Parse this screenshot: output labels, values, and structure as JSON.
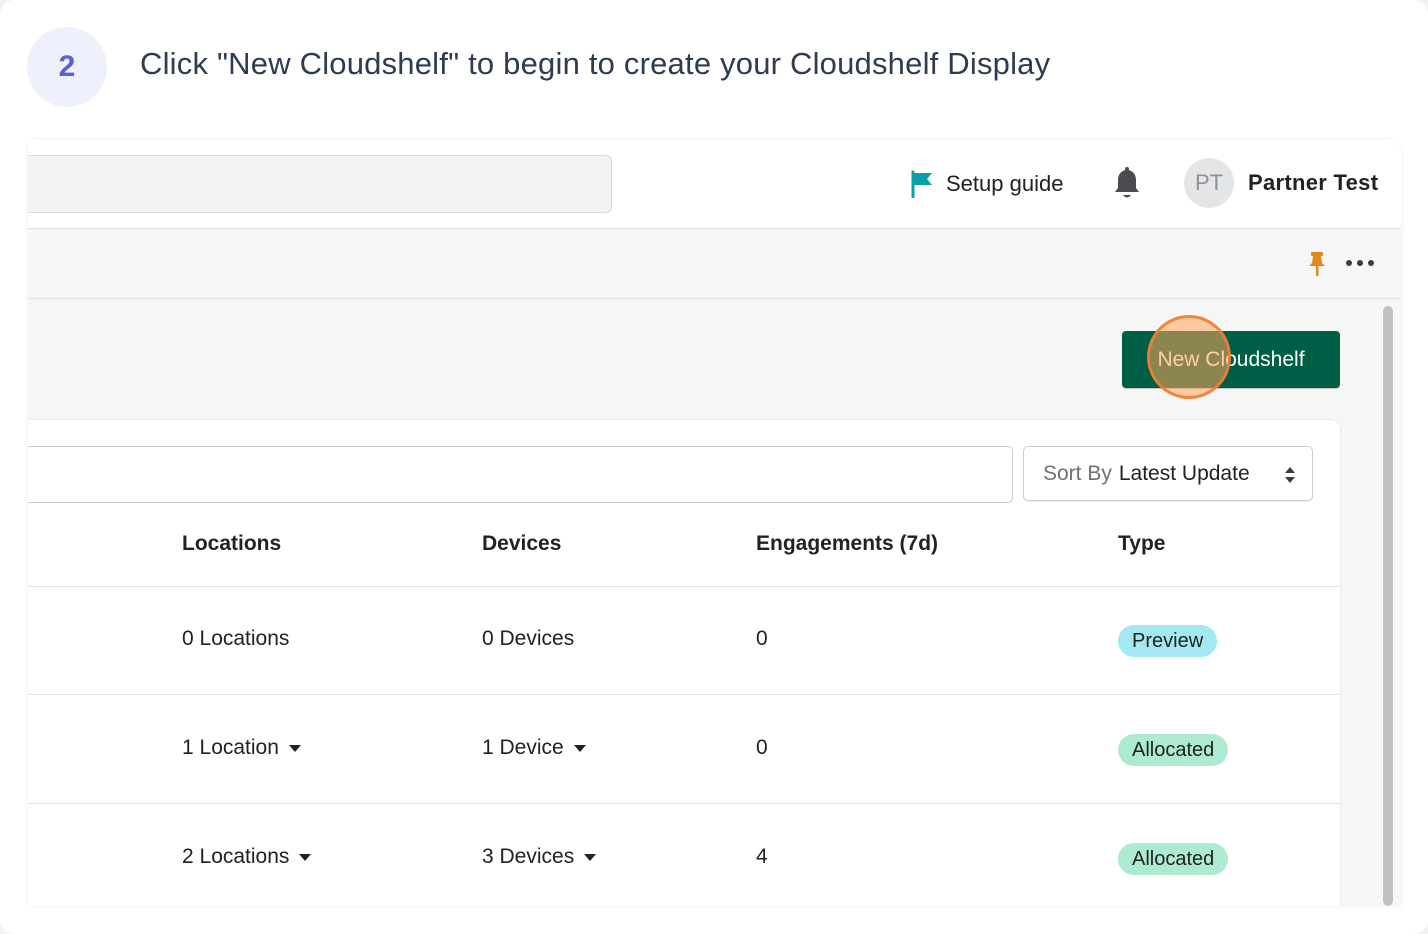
{
  "step": {
    "number": "2",
    "instruction": "Click \"New Cloudshelf\" to begin to create your Cloudshelf Display"
  },
  "topbar": {
    "setup_guide": "Setup guide",
    "avatar_initials": "PT",
    "user_name": "Partner Test"
  },
  "page": {
    "new_button_label": "New Cloudshelf",
    "sort": {
      "prefix": "Sort By",
      "selected": "Latest Update"
    }
  },
  "table": {
    "headers": [
      "Locations",
      "Devices",
      "Engagements (7d)",
      "Type"
    ],
    "rows": [
      {
        "locations": "0 Locations",
        "locations_dropdown": false,
        "devices": "0 Devices",
        "devices_dropdown": false,
        "engagements": "0",
        "type": "Preview"
      },
      {
        "locations": "1 Location",
        "locations_dropdown": true,
        "devices": "1 Device",
        "devices_dropdown": true,
        "engagements": "0",
        "type": "Allocated"
      },
      {
        "locations": "2 Locations",
        "locations_dropdown": true,
        "devices": "3 Devices",
        "devices_dropdown": true,
        "engagements": "4",
        "type": "Allocated"
      }
    ]
  },
  "colors": {
    "primary_button": "#005e46",
    "preview_badge": "#a4e8f2",
    "allocated_badge": "#aee9d1",
    "setup_flag": "#0a9ea8",
    "pin": "#e08a1a",
    "step_number": "#5a5fd8"
  },
  "icons": {
    "setup": "flag-icon",
    "notifications": "bell-icon",
    "pin": "pin-icon",
    "more": "more-horizontal-icon",
    "sort": "sort-arrows-icon",
    "dropdown": "caret-down-icon"
  }
}
